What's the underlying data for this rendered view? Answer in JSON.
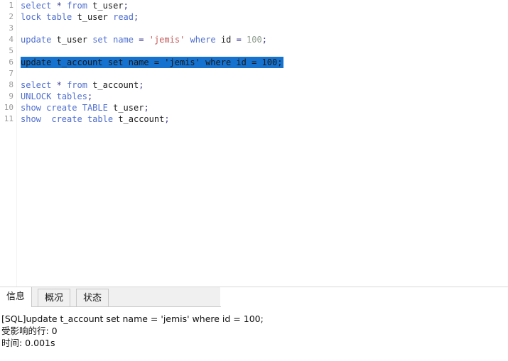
{
  "editor": {
    "lines": [
      {
        "number": "1",
        "selected": false,
        "tokens": [
          {
            "t": "select",
            "c": "kw"
          },
          {
            "t": " ",
            "c": "pl"
          },
          {
            "t": "*",
            "c": "op"
          },
          {
            "t": " ",
            "c": "pl"
          },
          {
            "t": "from",
            "c": "kw"
          },
          {
            "t": " ",
            "c": "pl"
          },
          {
            "t": "t_user",
            "c": "id"
          },
          {
            "t": ";",
            "c": "op"
          }
        ],
        "plain": "select * from t_user;"
      },
      {
        "number": "2",
        "selected": false,
        "tokens": [
          {
            "t": "lock",
            "c": "kw"
          },
          {
            "t": " ",
            "c": "pl"
          },
          {
            "t": "table",
            "c": "kw"
          },
          {
            "t": " ",
            "c": "pl"
          },
          {
            "t": "t_user",
            "c": "id"
          },
          {
            "t": " ",
            "c": "pl"
          },
          {
            "t": "read",
            "c": "kw"
          },
          {
            "t": ";",
            "c": "op"
          }
        ],
        "plain": "lock table t_user read;"
      },
      {
        "number": "3",
        "selected": false,
        "tokens": [],
        "plain": ""
      },
      {
        "number": "4",
        "selected": false,
        "tokens": [
          {
            "t": "update",
            "c": "kw"
          },
          {
            "t": " ",
            "c": "pl"
          },
          {
            "t": "t_user",
            "c": "id"
          },
          {
            "t": " ",
            "c": "pl"
          },
          {
            "t": "set",
            "c": "kw"
          },
          {
            "t": " ",
            "c": "pl"
          },
          {
            "t": "name",
            "c": "kw"
          },
          {
            "t": " ",
            "c": "pl"
          },
          {
            "t": "=",
            "c": "op"
          },
          {
            "t": " ",
            "c": "pl"
          },
          {
            "t": "'jemis'",
            "c": "str"
          },
          {
            "t": " ",
            "c": "pl"
          },
          {
            "t": "where",
            "c": "kw"
          },
          {
            "t": " ",
            "c": "pl"
          },
          {
            "t": "id",
            "c": "id"
          },
          {
            "t": " ",
            "c": "pl"
          },
          {
            "t": "=",
            "c": "op"
          },
          {
            "t": " ",
            "c": "pl"
          },
          {
            "t": "100",
            "c": "num"
          },
          {
            "t": ";",
            "c": "op"
          }
        ],
        "plain": "update t_user set name = 'jemis' where id = 100;"
      },
      {
        "number": "5",
        "selected": false,
        "tokens": [],
        "plain": ""
      },
      {
        "number": "6",
        "selected": true,
        "tokens": [
          {
            "t": "update t_account set name = 'jemis' where id = 100;",
            "c": "pl"
          }
        ],
        "plain": "update t_account set name = 'jemis' where id = 100;"
      },
      {
        "number": "7",
        "selected": false,
        "tokens": [],
        "plain": ""
      },
      {
        "number": "8",
        "selected": false,
        "tokens": [
          {
            "t": "select",
            "c": "kw"
          },
          {
            "t": " ",
            "c": "pl"
          },
          {
            "t": "*",
            "c": "op"
          },
          {
            "t": " ",
            "c": "pl"
          },
          {
            "t": "from",
            "c": "kw"
          },
          {
            "t": " ",
            "c": "pl"
          },
          {
            "t": "t_account",
            "c": "id"
          },
          {
            "t": ";",
            "c": "op"
          }
        ],
        "plain": "select * from t_account;"
      },
      {
        "number": "9",
        "selected": false,
        "tokens": [
          {
            "t": "UNLOCK",
            "c": "kw"
          },
          {
            "t": " ",
            "c": "pl"
          },
          {
            "t": "tables",
            "c": "kw"
          },
          {
            "t": ";",
            "c": "op"
          }
        ],
        "plain": "UNLOCK tables;"
      },
      {
        "number": "10",
        "selected": false,
        "tokens": [
          {
            "t": "show",
            "c": "kw"
          },
          {
            "t": " ",
            "c": "pl"
          },
          {
            "t": "create",
            "c": "kw"
          },
          {
            "t": " ",
            "c": "pl"
          },
          {
            "t": "TABLE",
            "c": "kw"
          },
          {
            "t": " ",
            "c": "pl"
          },
          {
            "t": "t_user",
            "c": "id"
          },
          {
            "t": ";",
            "c": "op"
          }
        ],
        "plain": "show create TABLE t_user;"
      },
      {
        "number": "11",
        "selected": false,
        "tokens": [
          {
            "t": "show",
            "c": "kw"
          },
          {
            "t": "  ",
            "c": "pl"
          },
          {
            "t": "create",
            "c": "kw"
          },
          {
            "t": " ",
            "c": "pl"
          },
          {
            "t": "table",
            "c": "kw"
          },
          {
            "t": " ",
            "c": "pl"
          },
          {
            "t": "t_account",
            "c": "id"
          },
          {
            "t": ";",
            "c": "op"
          }
        ],
        "plain": "show  create table t_account;"
      }
    ],
    "selection_color": "#1572CE",
    "selection_text_color": "#ffffff",
    "keyword_color": "#4f6fd0",
    "string_color": "#c45b5b",
    "number_color": "#8f9c8f",
    "identifier_color": "#1a1a1a",
    "line_number_color": "#9a9a9a"
  },
  "bottom_panel": {
    "tabs": [
      {
        "label": "信息",
        "active": true
      },
      {
        "label": "概况",
        "active": false
      },
      {
        "label": "状态",
        "active": false
      }
    ],
    "result_lines": [
      "[SQL]update t_account set name = 'jemis' where id = 100;",
      "受影响的行: 0",
      "时间: 0.001s"
    ]
  }
}
